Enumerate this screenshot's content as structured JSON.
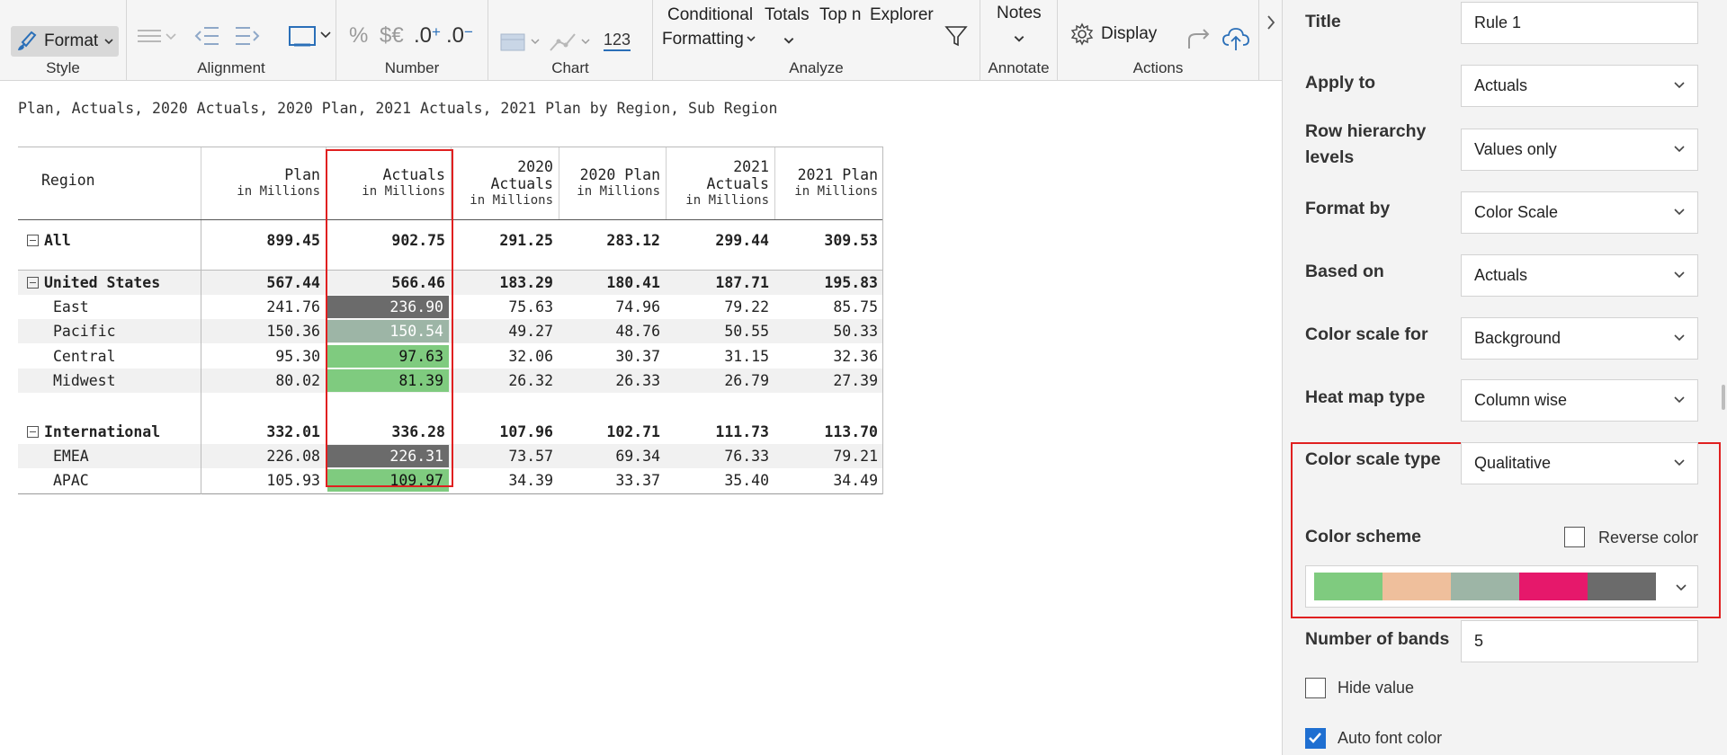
{
  "ribbon": {
    "format_label": "Format",
    "style_label": "Style",
    "alignment_label": "Alignment",
    "number_label": "Number",
    "percent_glyph": "%",
    "currency_glyph": "$€",
    "inc_decimal": ".0",
    "dec_decimal": ".0",
    "chart_label": "Chart",
    "chart_123": "123",
    "cond_fmt_line1": "Conditional",
    "cond_fmt_line2": "Formatting",
    "totals_label": "Totals",
    "topn_label": "Top n",
    "explorer_label": "Explorer",
    "analyze_label": "Analyze",
    "notes_label": "Notes",
    "annotate_label": "Annotate",
    "display_label": "Display",
    "actions_label": "Actions"
  },
  "report": {
    "subtitle": "Plan, Actuals, 2020 Actuals, 2020 Plan, 2021 Actuals, 2021 Plan by Region, Sub Region",
    "region_header": "Region",
    "unit": "in Millions",
    "columns": [
      {
        "line1": "",
        "line2": "Plan"
      },
      {
        "line1": "",
        "line2": "Actuals"
      },
      {
        "line1": "2020",
        "line2": "Actuals"
      },
      {
        "line1": "",
        "line2": "2020 Plan"
      },
      {
        "line1": "2021",
        "line2": "Actuals"
      },
      {
        "line1": "",
        "line2": "2021 Plan"
      }
    ],
    "rows": [
      {
        "label": "All",
        "values": [
          "899.45",
          "902.75",
          "291.25",
          "283.12",
          "299.44",
          "309.53"
        ]
      },
      {
        "label": "United States",
        "values": [
          "567.44",
          "566.46",
          "183.29",
          "180.41",
          "187.71",
          "195.83"
        ]
      },
      {
        "label": "East",
        "values": [
          "241.76",
          "236.90",
          "75.63",
          "74.96",
          "79.22",
          "85.75"
        ]
      },
      {
        "label": "Pacific",
        "values": [
          "150.36",
          "150.54",
          "49.27",
          "48.76",
          "50.55",
          "50.33"
        ]
      },
      {
        "label": "Central",
        "values": [
          "95.30",
          "97.63",
          "32.06",
          "30.37",
          "31.15",
          "32.36"
        ]
      },
      {
        "label": "Midwest",
        "values": [
          "80.02",
          "81.39",
          "26.32",
          "26.33",
          "26.79",
          "27.39"
        ]
      },
      {
        "label": "International",
        "values": [
          "332.01",
          "336.28",
          "107.96",
          "102.71",
          "111.73",
          "113.70"
        ]
      },
      {
        "label": "EMEA",
        "values": [
          "226.08",
          "226.31",
          "73.57",
          "69.34",
          "76.33",
          "79.21"
        ]
      },
      {
        "label": "APAC",
        "values": [
          "105.93",
          "109.97",
          "34.39",
          "33.37",
          "35.40",
          "34.49"
        ]
      }
    ],
    "heat_colors": {
      "East": "#6b6b6b",
      "Pacific": "#9db5a6",
      "Central": "#7fcb7f",
      "Midwest": "#7fcb7f",
      "EMEA": "#6b6b6b",
      "APAC": "#7fcb7f"
    }
  },
  "panel": {
    "title_label": "Title",
    "title_value": "Rule 1",
    "apply_to_label": "Apply to",
    "apply_to_value": "Actuals",
    "row_hier_label": "Row hierarchy levels",
    "row_hier_value": "Values only",
    "format_by_label": "Format by",
    "format_by_value": "Color Scale",
    "based_on_label": "Based on",
    "based_on_value": "Actuals",
    "color_scale_for_label": "Color scale for",
    "color_scale_for_value": "Background",
    "heat_map_type_label": "Heat map type",
    "heat_map_type_value": "Column wise",
    "color_scale_type_label": "Color scale type",
    "color_scale_type_value": "Qualitative",
    "color_scheme_label": "Color scheme",
    "reverse_color_label": "Reverse color",
    "scheme_colors": [
      "#7fcb7f",
      "#efbf9c",
      "#9db5a6",
      "#e6186b",
      "#6b6b6b"
    ],
    "bands_label": "Number of bands",
    "bands_value": "5",
    "hide_value_label": "Hide value",
    "auto_font_label": "Auto font color"
  }
}
